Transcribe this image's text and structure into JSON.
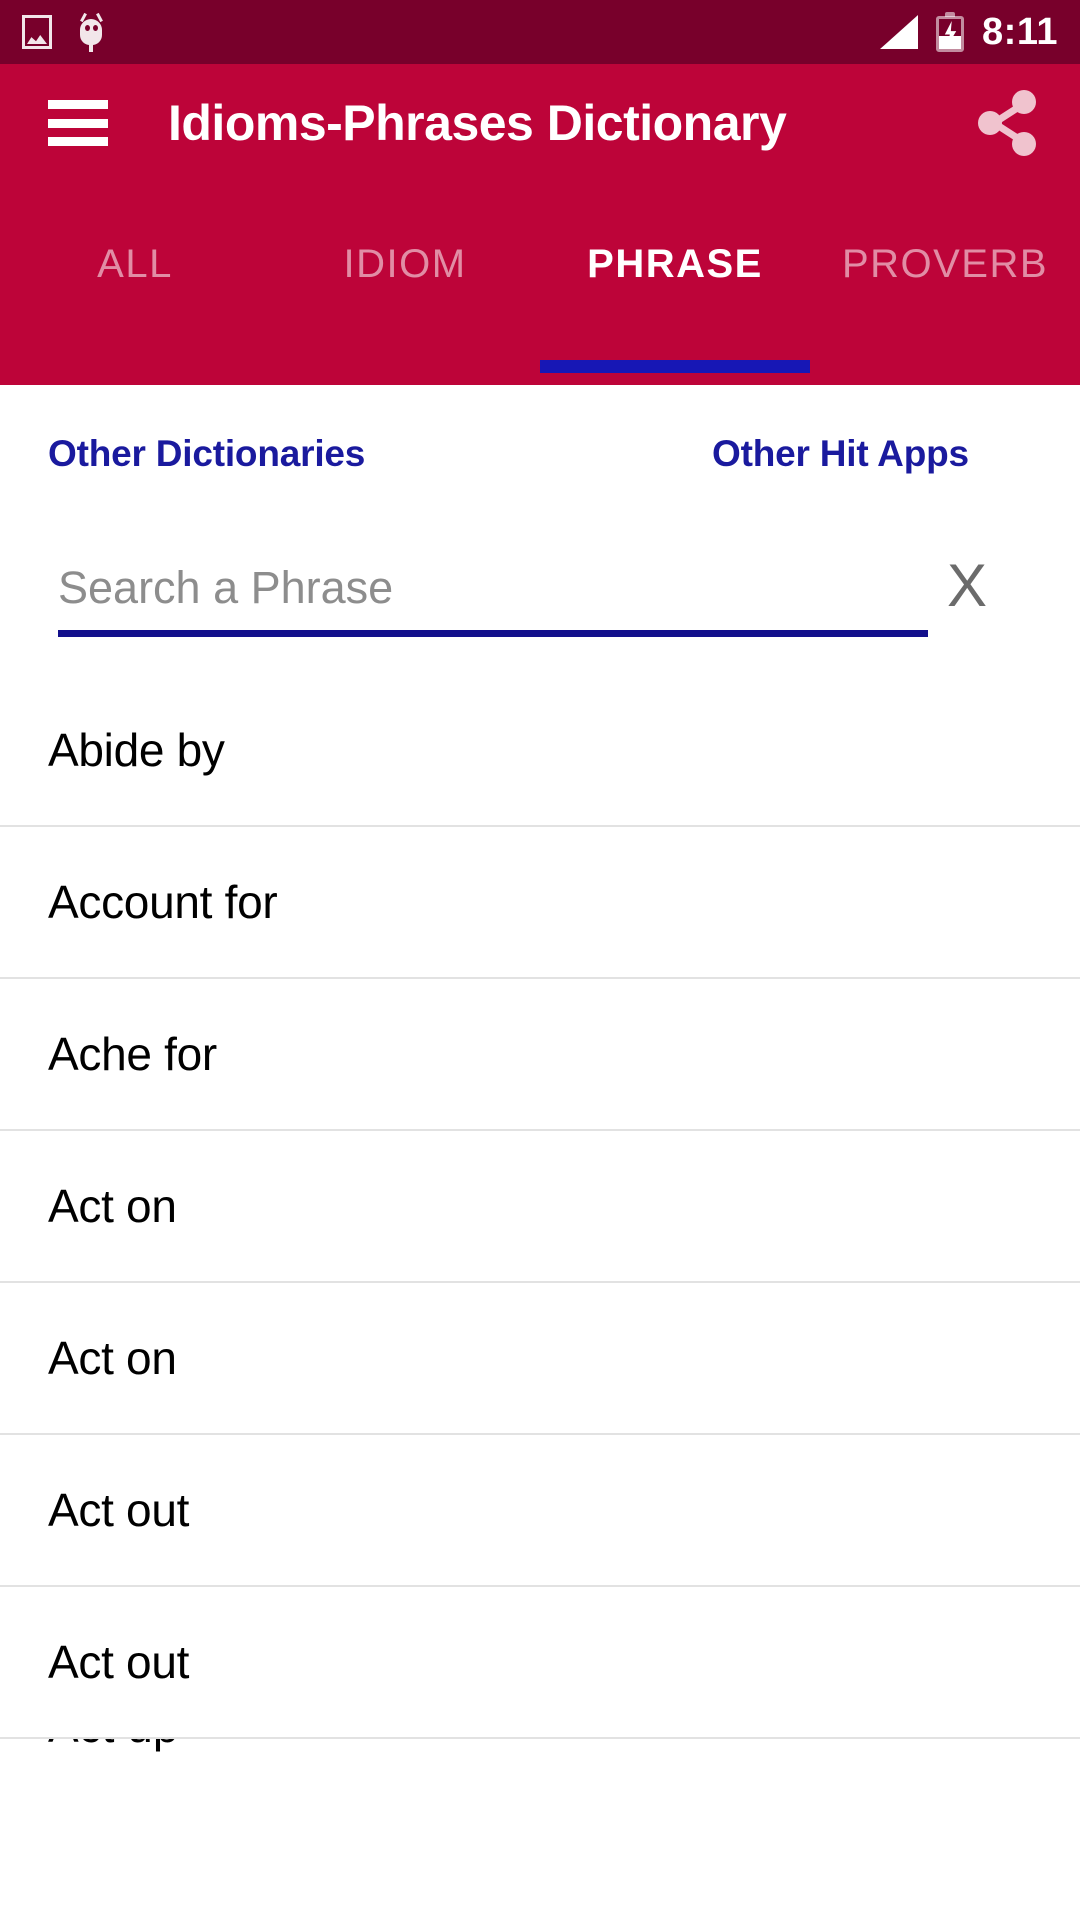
{
  "status_bar": {
    "time": "8:11",
    "icons": [
      "photo-icon",
      "android-bug-icon",
      "signal-icon",
      "battery-charging-icon"
    ],
    "background_color": "#78002b"
  },
  "app_bar": {
    "menu_icon": "hamburger-menu-icon",
    "title": "Idioms-Phrases Dictionary",
    "share_icon": "share-icon",
    "background_color": "#bd0439"
  },
  "tabs": {
    "active_index": 2,
    "indicator_color": "#1717b5",
    "items": [
      {
        "label": "ALL"
      },
      {
        "label": "IDIOM"
      },
      {
        "label": "PHRASE"
      },
      {
        "label": "PROVERB"
      }
    ]
  },
  "links": {
    "dictionaries": "Other Dictionaries",
    "hit_apps": "Other Hit Apps",
    "color": "#1a1a9e"
  },
  "search": {
    "placeholder": "Search a Phrase",
    "value": "",
    "clear_label": "X",
    "underline_color": "#13108c"
  },
  "list": {
    "items": [
      {
        "label": "Abide by"
      },
      {
        "label": "Account for"
      },
      {
        "label": "Ache for"
      },
      {
        "label": "Act on"
      },
      {
        "label": "Act on"
      },
      {
        "label": "Act out"
      },
      {
        "label": "Act out"
      }
    ],
    "partial_next_label": "Act up"
  }
}
